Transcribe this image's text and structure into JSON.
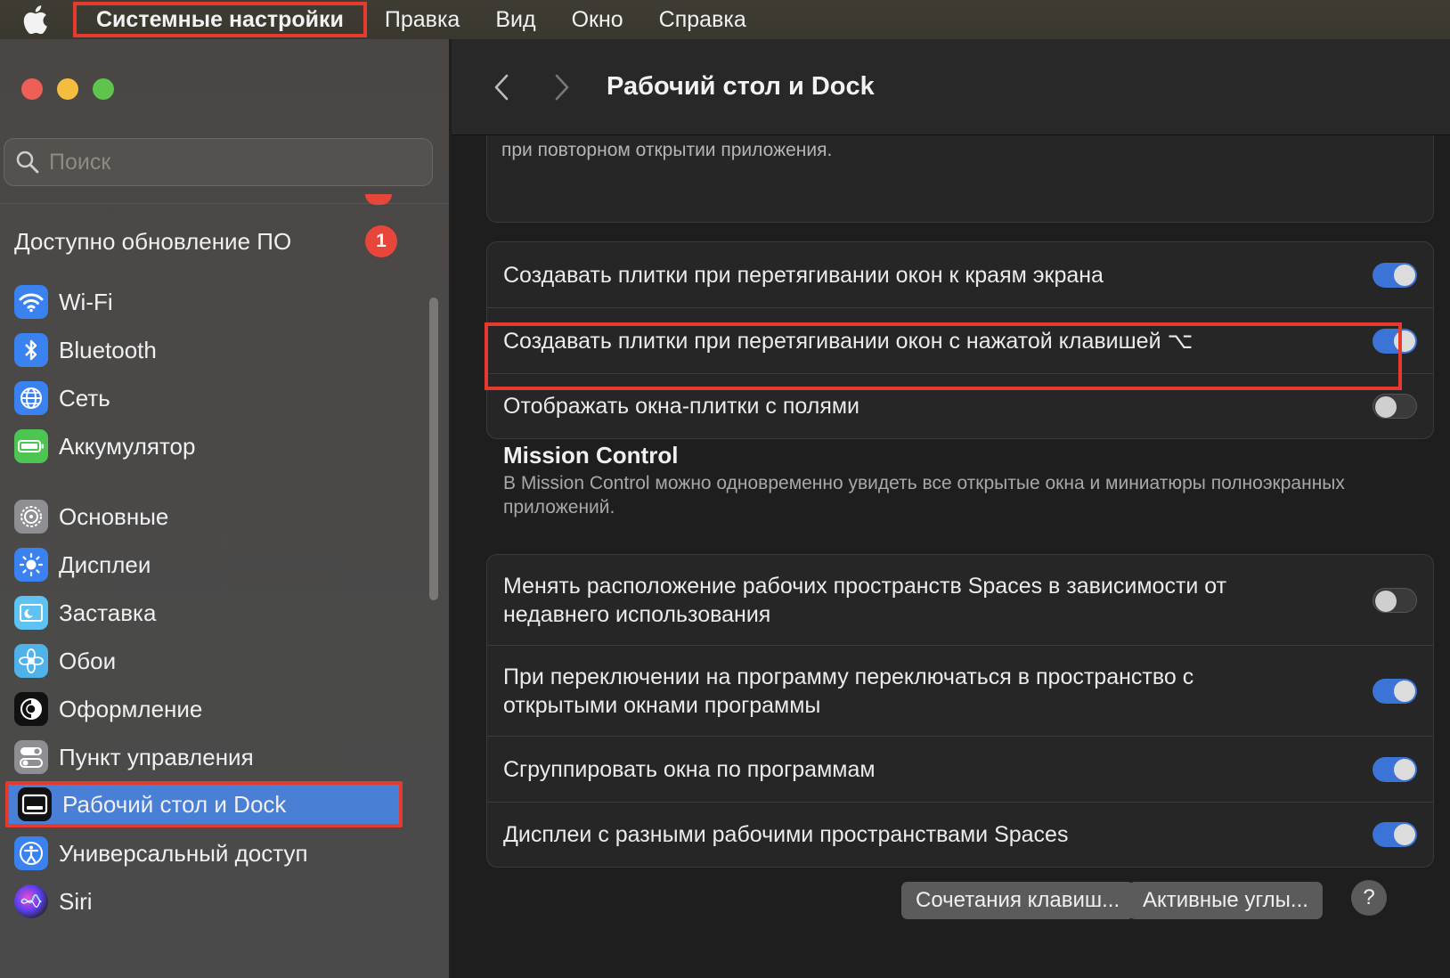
{
  "menubar": {
    "app_name": "Системные настройки",
    "items": [
      "Правка",
      "Вид",
      "Окно",
      "Справка"
    ]
  },
  "sidebar": {
    "search_placeholder": "Поиск",
    "update_label": "Доступно обновление ПО",
    "update_badge": "1",
    "items": [
      {
        "label": "Wi-Fi",
        "icon": "wifi-icon"
      },
      {
        "label": "Bluetooth",
        "icon": "bluetooth-icon"
      },
      {
        "label": "Сеть",
        "icon": "network-icon"
      },
      {
        "label": "Аккумулятор",
        "icon": "battery-icon"
      },
      {
        "label": "Основные",
        "icon": "gear-icon"
      },
      {
        "label": "Дисплеи",
        "icon": "sun-icon"
      },
      {
        "label": "Заставка",
        "icon": "screensaver-icon"
      },
      {
        "label": "Обои",
        "icon": "wallpaper-icon"
      },
      {
        "label": "Оформление",
        "icon": "appearance-icon"
      },
      {
        "label": "Пункт управления",
        "icon": "control-center-icon"
      },
      {
        "label": "Рабочий стол и Dock",
        "icon": "dock-icon",
        "selected": true
      },
      {
        "label": "Универсальный доступ",
        "icon": "accessibility-icon"
      },
      {
        "label": "Siri",
        "icon": "siri-icon"
      }
    ]
  },
  "toolbar": {
    "title": "Рабочий стол и Dock"
  },
  "main": {
    "truncated_text": "при повторном открытии приложения.",
    "tiling": [
      {
        "label": "Создавать плитки при перетягивании окон к краям экрана",
        "on": true
      },
      {
        "label": "Создавать плитки при перетягивании окон с нажатой клавишей ⌥",
        "on": true
      },
      {
        "label": "Отображать окна-плитки с полями",
        "on": false
      }
    ],
    "mission_control": {
      "title": "Mission Control",
      "description": "В Mission Control можно одновременно увидеть все открытые окна и миниатюры полноэкранных приложений."
    },
    "mc_rows": [
      {
        "label": "Менять расположение рабочих пространств Spaces в зависимости от недавнего использования",
        "on": false
      },
      {
        "label": "При переключении на программу переключаться в пространство с открытыми окнами программы",
        "on": true
      },
      {
        "label": "Сгруппировать окна по программам",
        "on": true
      },
      {
        "label": "Дисплеи с разными рабочими пространствами Spaces",
        "on": true
      }
    ],
    "buttons": {
      "shortcuts": "Сочетания клавиш...",
      "hot_corners": "Активные углы...",
      "help": "?"
    }
  },
  "colors": {
    "accent": "#3b73d6",
    "selection": "#4a7fd6",
    "annotation_red": "#e53a2e",
    "badge_red": "#e8453b"
  }
}
